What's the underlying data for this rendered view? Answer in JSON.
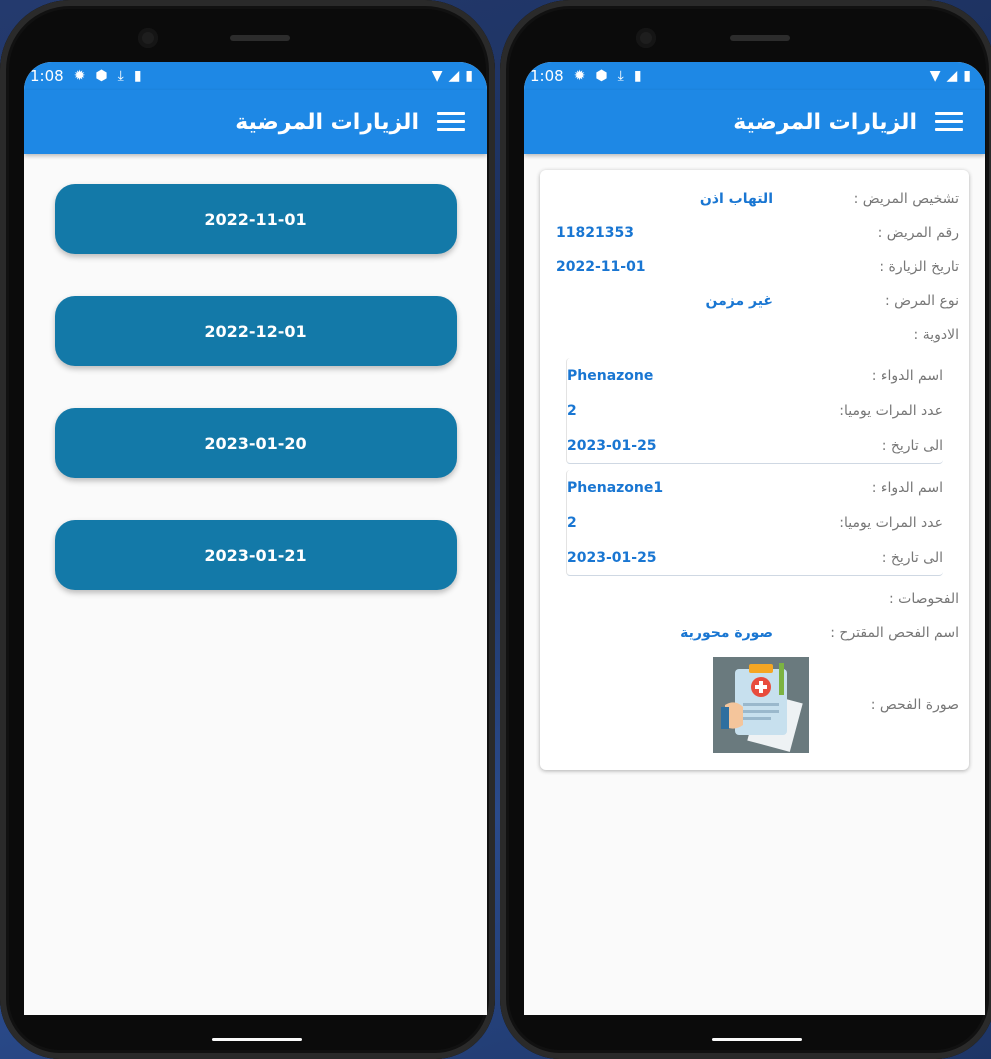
{
  "status": {
    "time": "1:08"
  },
  "app": {
    "title": "الزيارات المرضية"
  },
  "visits": [
    {
      "date": "2022-11-01"
    },
    {
      "date": "2022-12-01"
    },
    {
      "date": "2023-01-20"
    },
    {
      "date": "2023-01-21"
    }
  ],
  "detail": {
    "diagnosis_label": "تشخيص المريض :",
    "diagnosis_value": "التهاب اذن",
    "patient_no_label": "رقم المريض :",
    "patient_no_value": "11821353",
    "visit_date_label": "تاريخ الزيارة :",
    "visit_date_value": "2022-11-01",
    "disease_type_label": "نوع المرض :",
    "disease_type_value": "غير مزمن",
    "medicines_label": "الادوية :",
    "medicines": [
      {
        "name_label": "اسم الدواء :",
        "name_value": "Phenazone",
        "times_label": "عدد المرات يوميا:",
        "times_value": "2",
        "until_label": "الى تاريخ :",
        "until_value": "2023-01-25"
      },
      {
        "name_label": "اسم الدواء :",
        "name_value": "Phenazone1",
        "times_label": "عدد المرات يوميا:",
        "times_value": "2",
        "until_label": "الى تاريخ :",
        "until_value": "2023-01-25"
      }
    ],
    "exams_label": "الفحوصات :",
    "exam_name_label": "اسم الفحص المقترح :",
    "exam_name_value": "صورة محورية",
    "exam_image_label": "صورة الفحص :"
  },
  "icons": {
    "status_left": [
      "settings-icon",
      "shield-icon",
      "download-icon",
      "sd-card-icon"
    ],
    "status_right": [
      "wifi-icon",
      "signal-icon",
      "battery-icon"
    ],
    "menu": "menu-icon"
  },
  "colors": {
    "appbar": "#1e88e5",
    "visit_button": "#1379a8",
    "value_text": "#1976d2"
  }
}
